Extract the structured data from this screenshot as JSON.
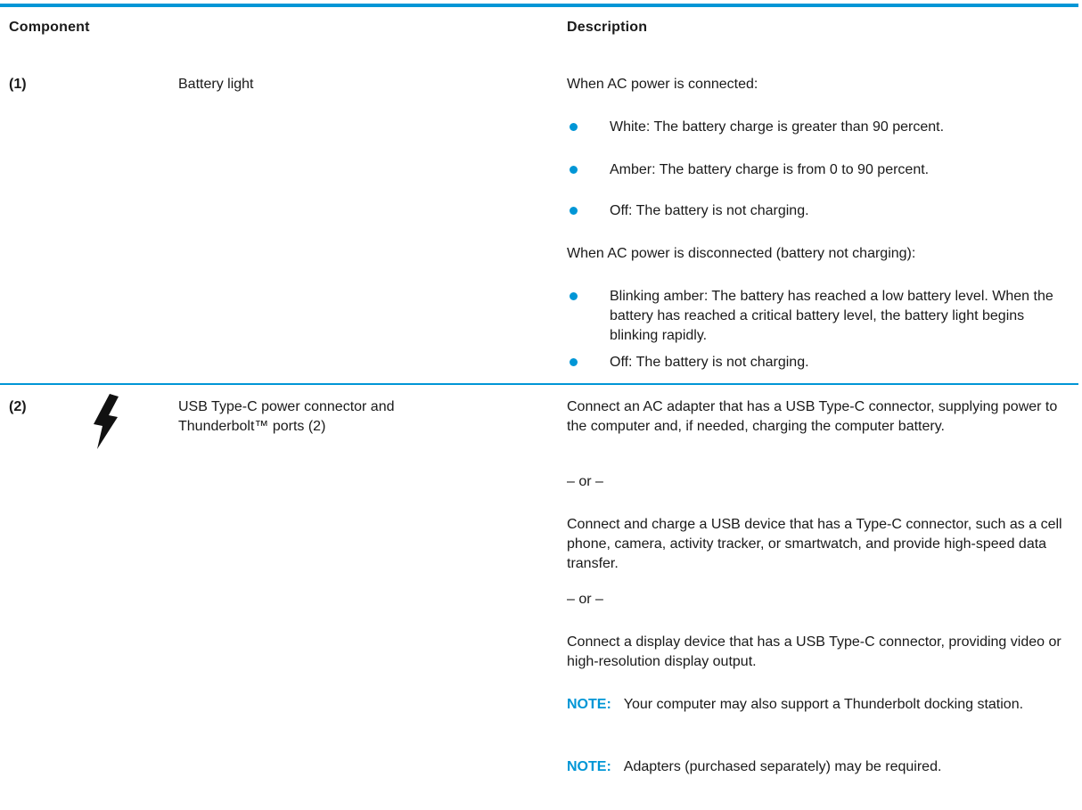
{
  "table": {
    "headers": {
      "component": "Component",
      "description": "Description"
    },
    "row1": {
      "number": "(1)",
      "component": "Battery light",
      "icon": "none",
      "ac_connected": "When AC power is connected:",
      "ac_bullets": [
        "White: The battery charge is greater than 90 percent.",
        "Amber: The battery charge is from 0 to 90 percent.",
        "Off: The battery is not charging."
      ],
      "ac_disconnected": "When AC power is disconnected (battery not charging):",
      "dc_bullets": [
        "Blinking amber: The battery has reached a low battery level. When the battery has reached a critical battery level, the battery light begins blinking rapidly.",
        "Off: The battery is not charging."
      ]
    },
    "row2": {
      "number": "(2)",
      "icon": "lightning-bolt-icon",
      "component": "USB Type-C power connector and Thunderbolt™ ports (2)",
      "p1": "Connect an AC adapter that has a USB Type-C connector, supplying power to the computer and, if needed, charging the computer battery.",
      "or1": "– or –",
      "p2": "Connect and charge a USB device that has a Type-C connector, such as a cell phone, camera, activity tracker, or smartwatch, and provide high-speed data transfer.",
      "or2": "– or –",
      "p3": "Connect a display device that has a USB Type-C connector, providing video or high-resolution display output.",
      "note1_label": "NOTE:",
      "note1_text": "Your computer may also support a Thunderbolt docking station.",
      "note2_label": "NOTE:",
      "note2_text": "Adapters (purchased separately) may be required."
    }
  },
  "colors": {
    "accent": "#0096d6",
    "text": "#1a1a1a"
  }
}
